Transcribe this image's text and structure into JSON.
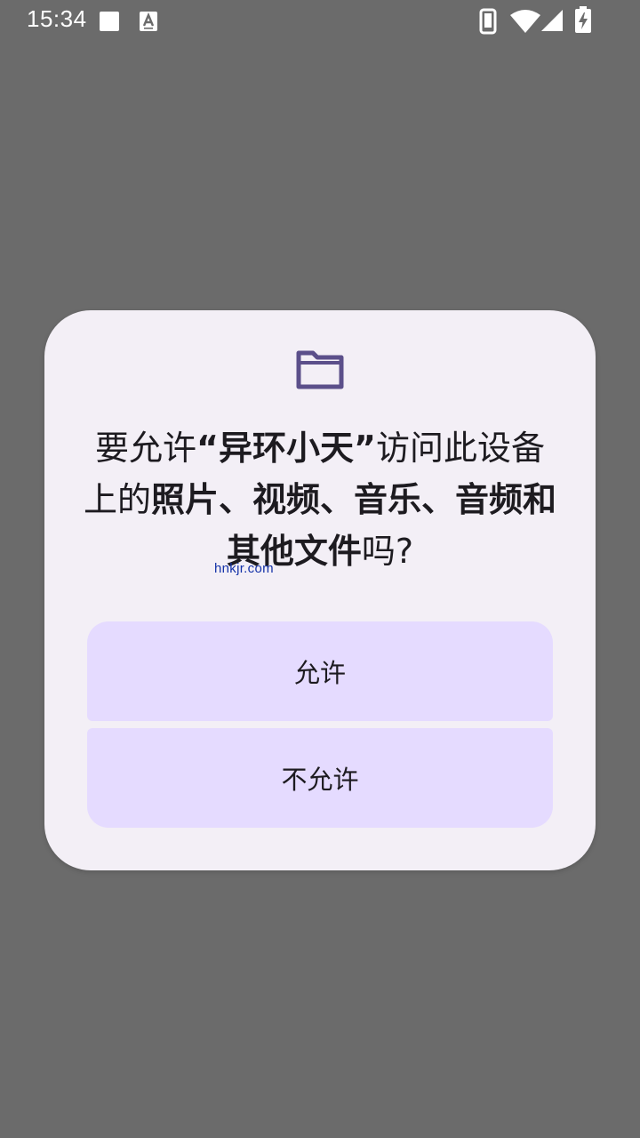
{
  "status_bar": {
    "time": "15:34",
    "icons": [
      "notification-square-icon",
      "keyboard-a-icon",
      "phone-icon",
      "wifi-icon",
      "signal-icon",
      "battery-charging-icon"
    ]
  },
  "dialog": {
    "icon": "folder-icon",
    "message": {
      "part1": "要允许",
      "app_name": "“异环小天”",
      "part2": "访问此设备上的",
      "item1": "照片",
      "sep1": "、",
      "item2": "视频",
      "sep2": "、",
      "item3": "音乐",
      "sep3": "、",
      "item4": "音频和其他文件",
      "part3": "吗?"
    },
    "watermark": "hnkjr.com",
    "allow_label": "允许",
    "deny_label": "不允许"
  },
  "colors": {
    "scrim": "#6b6b6b",
    "dialog_bg": "#f3eff6",
    "button_bg": "#e5dbff",
    "icon_accent": "#5b4f8a"
  }
}
